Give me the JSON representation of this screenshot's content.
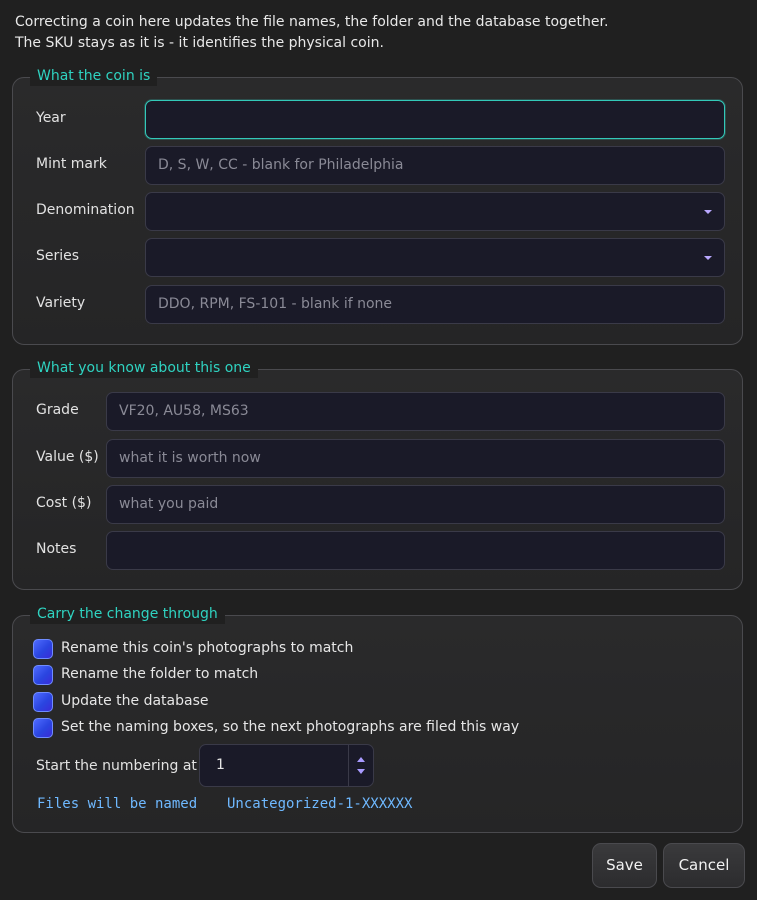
{
  "intro": {
    "line1": "Correcting a coin here updates the file names, the folder and the database together.",
    "line2": "The SKU stays as it is - it identifies the physical coin."
  },
  "coin_group": {
    "title": "What the coin is",
    "year": {
      "label": "Year",
      "value": "",
      "placeholder": ""
    },
    "mint_mark": {
      "label": "Mint mark",
      "value": "",
      "placeholder": "D, S, W, CC - blank for Philadelphia"
    },
    "denomination": {
      "label": "Denomination",
      "value": ""
    },
    "series": {
      "label": "Series",
      "value": ""
    },
    "variety": {
      "label": "Variety",
      "value": "",
      "placeholder": "DDO, RPM, FS-101 - blank if none"
    }
  },
  "know_group": {
    "title": "What you know about this one",
    "grade": {
      "label": "Grade",
      "value": "",
      "placeholder": "VF20, AU58, MS63"
    },
    "value": {
      "label": "Value ($)",
      "value": "",
      "placeholder": "what it is worth now"
    },
    "cost": {
      "label": "Cost ($)",
      "value": "",
      "placeholder": "what you paid"
    },
    "notes": {
      "label": "Notes",
      "value": "",
      "placeholder": ""
    }
  },
  "carry_group": {
    "title": "Carry the change through",
    "checks": [
      {
        "label": "Rename this coin's photographs to match",
        "checked": true
      },
      {
        "label": "Rename the folder to match",
        "checked": true
      },
      {
        "label": "Update the database",
        "checked": true
      },
      {
        "label": "Set the naming boxes, so the next photographs are filed this way",
        "checked": true
      }
    ],
    "start_numbering": {
      "label": "Start the numbering at",
      "value": "1"
    },
    "files_named": {
      "label": "Files will be named",
      "value": "Uncategorized-1-XXXXXX"
    }
  },
  "buttons": {
    "save": "Save",
    "cancel": "Cancel"
  },
  "colors": {
    "accent": "#2fd3c1",
    "checkbox": "#3a55f0",
    "mono_text": "#6fb9ff"
  },
  "icons": {
    "dropdown": "chevron-down-icon",
    "spin_up": "spin-up-icon",
    "spin_down": "spin-down-icon"
  }
}
